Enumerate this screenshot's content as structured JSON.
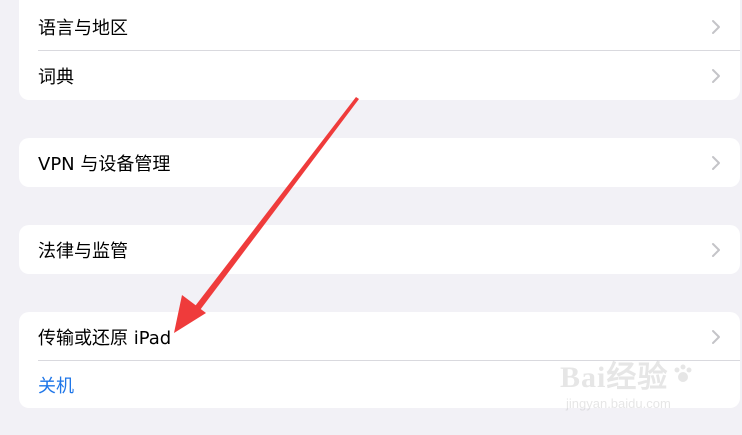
{
  "groups": {
    "general": {
      "rows": [
        {
          "label": "语言与地区"
        },
        {
          "label": "词典"
        }
      ]
    },
    "vpn": {
      "label": "VPN 与设备管理"
    },
    "legal": {
      "label": "法律与监管"
    },
    "reset": {
      "transfer_label": "传输或还原 iPad",
      "shutdown_label": "关机"
    }
  },
  "watermark": {
    "brand": "Bai经验",
    "sub": "jingyan.baidu.com"
  },
  "colors": {
    "background": "#f2f1f6",
    "card": "#ffffff",
    "accent": "#1f76e8",
    "annotation_arrow": "#ef3b3b",
    "chevron": "#c4c4c8"
  },
  "icons": {
    "chevron": "chevron-right-icon"
  }
}
